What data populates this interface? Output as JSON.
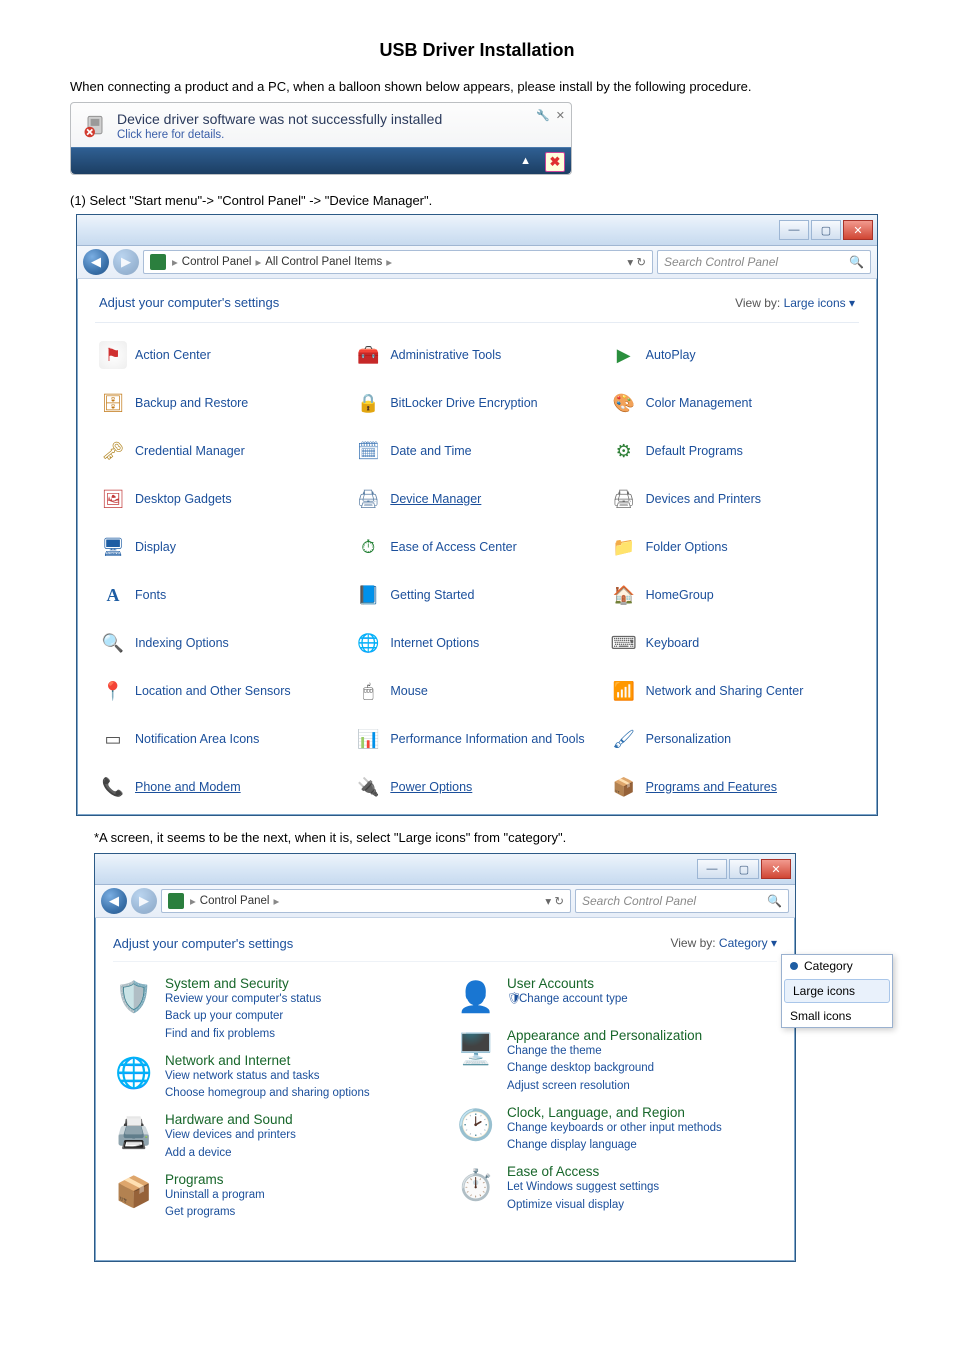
{
  "page": {
    "title": "USB Driver Installation",
    "intro": "When connecting a product and a PC,  when a balloon shown below appears, please install by the following procedure.",
    "step1": "(1)  Select  \"Start menu\"-> \"Control Panel\" -> \"Device Manager\".",
    "note": "*A screen, it seems to be the next, when it is, select \"Large icons\" from \"category\"."
  },
  "balloon": {
    "title": "Device driver software was not successfully installed",
    "subtitle": "Click here for details.",
    "wrench_name": "wrench-icon",
    "close_name": "close-icon"
  },
  "win1": {
    "breadcrumb_a": "Control Panel",
    "breadcrumb_b": "All Control Panel Items",
    "search_placeholder": "Search Control Panel",
    "adjust_label": "Adjust your computer's settings",
    "viewby_label": "View by:",
    "viewby_value": "Large icons",
    "items": [
      {
        "label": "Action Center",
        "ico": "flag"
      },
      {
        "label": "Administrative Tools",
        "ico": "admin"
      },
      {
        "label": "AutoPlay",
        "ico": "autoplay"
      },
      {
        "label": "Backup and Restore",
        "ico": "backup"
      },
      {
        "label": "BitLocker Drive Encryption",
        "ico": "bitlocker"
      },
      {
        "label": "Color Management",
        "ico": "colormgmt"
      },
      {
        "label": "Credential Manager",
        "ico": "cred"
      },
      {
        "label": "Date and Time",
        "ico": "datetime"
      },
      {
        "label": "Default Programs",
        "ico": "default"
      },
      {
        "label": "Desktop Gadgets",
        "ico": "gadgets"
      },
      {
        "label": "Device Manager",
        "ico": "devmgr",
        "underline": true
      },
      {
        "label": "Devices and Printers",
        "ico": "devprint"
      },
      {
        "label": "Display",
        "ico": "display"
      },
      {
        "label": "Ease of Access Center",
        "ico": "ease"
      },
      {
        "label": "Folder Options",
        "ico": "folder"
      },
      {
        "label": "Fonts",
        "ico": "fonts"
      },
      {
        "label": "Getting Started",
        "ico": "getstart"
      },
      {
        "label": "HomeGroup",
        "ico": "homegrp"
      },
      {
        "label": "Indexing Options",
        "ico": "indexopt"
      },
      {
        "label": "Internet Options",
        "ico": "inetopt"
      },
      {
        "label": "Keyboard",
        "ico": "keyboard"
      },
      {
        "label": "Location and Other Sensors",
        "ico": "location"
      },
      {
        "label": "Mouse",
        "ico": "mouse"
      },
      {
        "label": "Network and Sharing Center",
        "ico": "network"
      },
      {
        "label": "Notification Area Icons",
        "ico": "notif"
      },
      {
        "label": "Performance Information and Tools",
        "ico": "perf"
      },
      {
        "label": "Personalization",
        "ico": "personal"
      },
      {
        "label": "Phone and Modem",
        "ico": "phone",
        "underline": true
      },
      {
        "label": "Power Options",
        "ico": "power",
        "underline": true
      },
      {
        "label": "Programs and Features",
        "ico": "progs",
        "underline": true
      }
    ]
  },
  "win2": {
    "breadcrumb_a": "Control Panel",
    "search_placeholder": "Search Control Panel",
    "adjust_label": "Adjust your computer's settings",
    "viewby_label": "View by:",
    "viewby_value": "Category",
    "menu": {
      "category": "Category",
      "large": "Large icons",
      "small": "Small icons"
    },
    "cats": {
      "sys": {
        "head": "System and Security",
        "links": [
          "Review your computer's status",
          "Back up your computer",
          "Find and fix problems"
        ]
      },
      "net": {
        "head": "Network and Internet",
        "links": [
          "View network status and tasks",
          "Choose homegroup and sharing options"
        ]
      },
      "hw": {
        "head": "Hardware and Sound",
        "links": [
          "View devices and printers",
          "Add a device"
        ]
      },
      "prog": {
        "head": "Programs",
        "links": [
          "Uninstall a program",
          "Get programs"
        ]
      },
      "ua": {
        "head": "User Accounts",
        "links": [
          "Change account type"
        ]
      },
      "ap": {
        "head": "Appearance and Personalization",
        "links": [
          "Change the theme",
          "Change desktop background",
          "Adjust screen resolution"
        ]
      },
      "clk": {
        "head": "Clock, Language, and Region",
        "links": [
          "Change keyboards or other input methods",
          "Change display language"
        ]
      },
      "eoa": {
        "head": "Ease of Access",
        "links": [
          "Let Windows suggest settings",
          "Optimize visual display"
        ]
      }
    }
  }
}
